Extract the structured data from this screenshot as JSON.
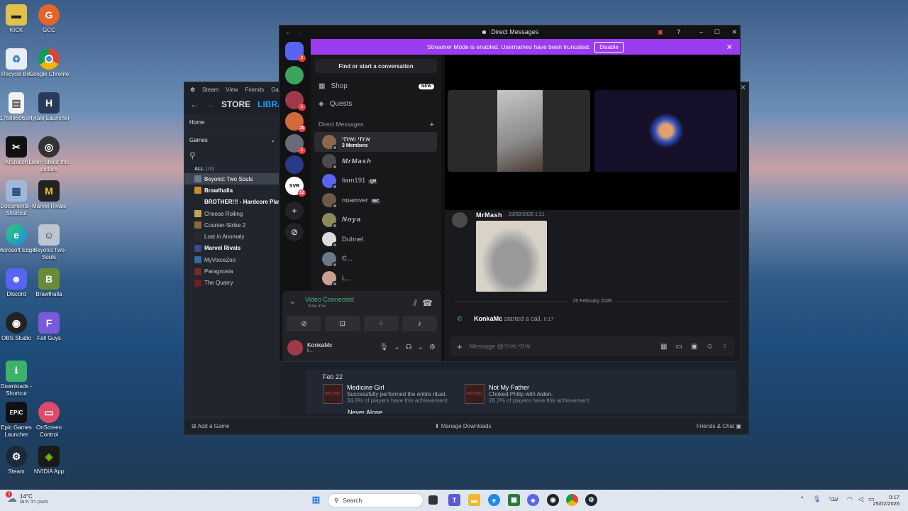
{
  "desktop": {
    "icons": [
      {
        "label": "KICK",
        "icon": "kick-folder-icon"
      },
      {
        "label": "GCC",
        "icon": "gcc-icon"
      },
      {
        "label": "Recycle Bin",
        "icon": "recycle-bin-icon"
      },
      {
        "label": "Google Chrome",
        "icon": "chrome-icon"
      },
      {
        "label": "176886065...",
        "icon": "file-icon"
      },
      {
        "label": "Hytale Launcher",
        "icon": "hytale-icon"
      },
      {
        "label": "AISnatch",
        "icon": "aisnatch-icon"
      },
      {
        "label": "Learn about this picture",
        "icon": "camera-icon"
      },
      {
        "label": "Documents - Shortcut",
        "icon": "documents-icon"
      },
      {
        "label": "Marvel Rivals",
        "icon": "marvel-rivals-icon"
      },
      {
        "label": "Microsoft Edge",
        "icon": "edge-icon"
      },
      {
        "label": "Beyond Two Souls",
        "icon": "beyond-two-souls-icon"
      },
      {
        "label": "Discord",
        "icon": "discord-icon"
      },
      {
        "label": "Brawlhalla",
        "icon": "brawlhalla-icon"
      },
      {
        "label": "OBS Studio",
        "icon": "obs-icon"
      },
      {
        "label": "Fall Guys",
        "icon": "fall-guys-icon"
      },
      {
        "label": "Downloads - Shortcut",
        "icon": "downloads-icon"
      },
      {
        "label": "Epic Games Launcher",
        "icon": "epic-games-icon"
      },
      {
        "label": "OnScreen Control",
        "icon": "onscreen-control-icon"
      },
      {
        "label": "Steam",
        "icon": "steam-icon"
      },
      {
        "label": "NVIDIA App",
        "icon": "nvidia-icon"
      }
    ]
  },
  "steam": {
    "menu": [
      "Steam",
      "View",
      "Friends",
      "Games"
    ],
    "nav": {
      "store": "STORE",
      "library": "LIBRARY"
    },
    "home": "Home",
    "games_label": "Games",
    "all_label": "ALL",
    "all_count": "(10)",
    "games": [
      {
        "name": "Beyond: Two Souls",
        "color": "#6a7b8c"
      },
      {
        "name": "Brawlhalla",
        "color": "#d08a2a"
      },
      {
        "name": "BROTHER!!! - Hardcore Plat",
        "color": "#222222"
      },
      {
        "name": "Cheese Rolling",
        "color": "#c9a44a"
      },
      {
        "name": "Counter-Strike 2",
        "color": "#8a6a2a"
      },
      {
        "name": "Lost in Anomaly",
        "color": "#2a2a2a"
      },
      {
        "name": "Marvel Rivals",
        "color": "#3a4a8a"
      },
      {
        "name": "MyVoiceZoo",
        "color": "#3a6a9a"
      },
      {
        "name": "Paragnosia",
        "color": "#7a2a2a"
      },
      {
        "name": "The Quarry",
        "color": "#7a1a1a"
      }
    ],
    "achievements": {
      "date": "Feb 22",
      "items": [
        {
          "title": "Medicine Girl",
          "desc": "Successfully performed the entire ritual.",
          "pct": "34.6% of players have this achievement"
        },
        {
          "title": "Not My Father",
          "desc": "Choked Philip with Aiden.",
          "pct": "26.2% of players have this achievement"
        },
        {
          "title": "Never Alone",
          "desc": "",
          "pct": ""
        }
      ],
      "thumb_text": "BEYOND"
    },
    "footer": {
      "add_game": "Add a Game",
      "downloads": "Manage Downloads",
      "friends": "Friends & Chat"
    }
  },
  "discord": {
    "title": "Direct Messages",
    "banner": {
      "text": "Streamer Mode is enabled. Usernames have been truncated.",
      "button": "Disable"
    },
    "servers": [
      {
        "badge": "3",
        "color": "#5865f2",
        "icon": "discord-home-icon"
      },
      {
        "badge": "",
        "color": "#3ba55d",
        "icon": "server-avatar-icon"
      },
      {
        "badge": "1",
        "color": "#a03a4a",
        "icon": "server-avatar-icon"
      },
      {
        "badge": "20",
        "color": "#d06a3a",
        "icon": "server-avatar-icon"
      },
      {
        "badge": "1",
        "color": "#6a6a7a",
        "icon": "server-avatar-icon"
      },
      {
        "badge": "",
        "color": "#2a3a8a",
        "icon": "server-avatar-icon"
      },
      {
        "badge": "12",
        "color": "#ffffff",
        "icon": "server-avatar-icon",
        "text": "SVR"
      }
    ],
    "find": "Find or start a conversation",
    "nav": [
      {
        "label": "Shop",
        "icon": "shop-icon",
        "badge": "NEW"
      },
      {
        "label": "Quests",
        "icon": "quests-icon",
        "badge": ""
      }
    ],
    "dm_header": "Direct Messages",
    "dms": [
      {
        "name": "איתי ואיתי",
        "sub": "3 Members",
        "color": "#8a6a4a",
        "tag": ""
      },
      {
        "name": "MrMash",
        "sub": "",
        "color": "#4a4a4a",
        "tag": ""
      },
      {
        "name": "liam191",
        "sub": "",
        "color": "#5865f2",
        "tag": "QR"
      },
      {
        "name": "noamver",
        "sub": "",
        "color": "#6a5a4a",
        "tag": "MC"
      },
      {
        "name": "Noya",
        "sub": "",
        "color": "#8a8a5a",
        "tag": ""
      },
      {
        "name": "Duhnel",
        "sub": "",
        "color": "#dddddd",
        "tag": ""
      },
      {
        "name": "Є...",
        "sub": "",
        "color": "#6a7a8a",
        "tag": ""
      },
      {
        "name": "L...",
        "sub": "",
        "color": "#c9a090",
        "tag": ""
      }
    ],
    "voice": {
      "status": "Video Connected",
      "channel": "איתי ואיתי"
    },
    "user": {
      "name": "KonkaMc",
      "sub": "k..."
    },
    "message": {
      "author": "MrMash",
      "time": "23/02/2026 1:21"
    },
    "divider": "25 February 2026",
    "call": {
      "who": "KonkaMc",
      "text": "started a call.",
      "dur": "0:17"
    },
    "input_placeholder": "Message @איתי ואיתי"
  },
  "taskbar": {
    "weather_temp": "14°C",
    "weather_desc": "מעונן רב היום",
    "weather_badge": "3",
    "search": "Search",
    "lang": "עבר",
    "time": "0:17",
    "date": "25/02/2026"
  }
}
